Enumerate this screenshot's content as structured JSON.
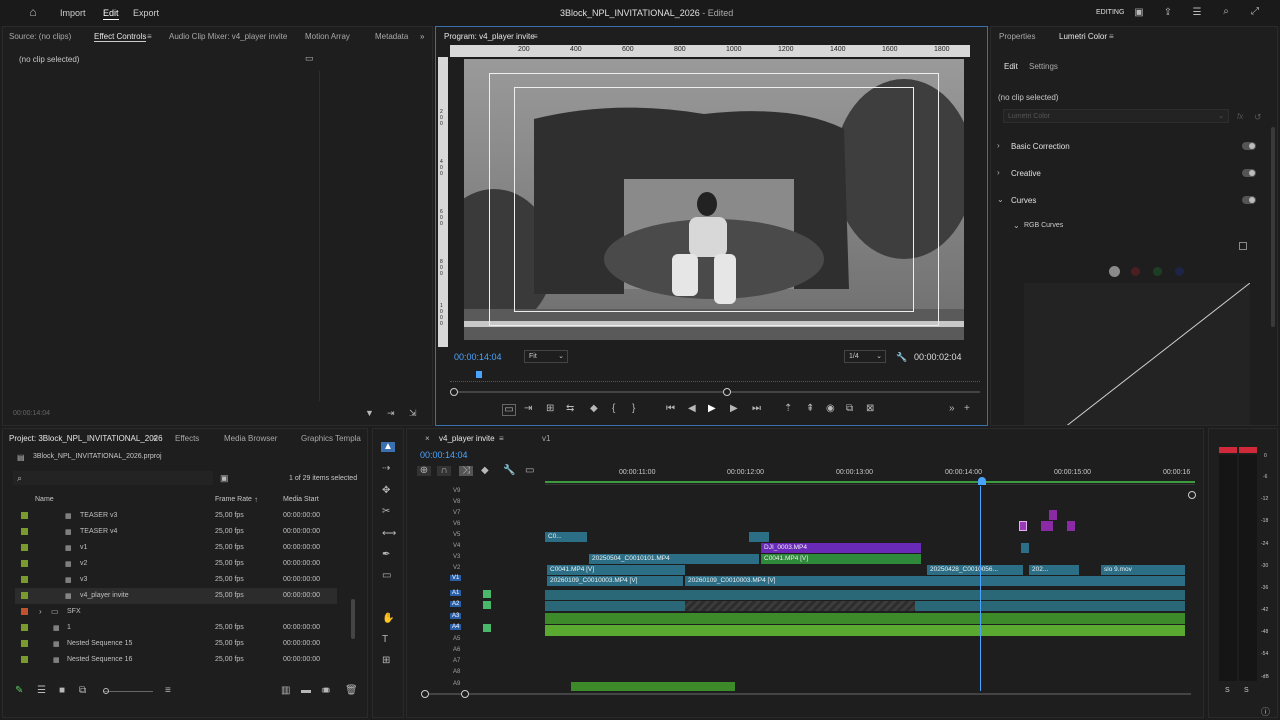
{
  "header": {
    "home_icon": "home-icon",
    "menu": [
      "Import",
      "Edit",
      "Export"
    ],
    "active_menu": "Edit",
    "title": "3Block_NPL_INVITATIONAL_2026",
    "status": "- Edited",
    "workspace": "EDITING"
  },
  "source_panel": {
    "tabs": [
      "Source: (no clips)",
      "Effect Controls",
      "Audio Clip Mixer: v4_player invite",
      "Motion Array",
      "Metadata"
    ],
    "no_clip": "(no clip selected)",
    "timecode": "00:00:14:04"
  },
  "program": {
    "tab": "Program: v4_player invite",
    "ruler": [
      "200",
      "400",
      "600",
      "800",
      "1000",
      "1200",
      "1400",
      "1600",
      "1800"
    ],
    "vruler": [
      "2 0 0",
      "4 0 0",
      "6 0 0",
      "8 0 0",
      "1 0 0 0"
    ],
    "timecode": "00:00:14:04",
    "fit": "Fit",
    "resolution": "1/4",
    "duration": "00:00:02:04"
  },
  "lumetri": {
    "tabs": [
      "Properties",
      "Lumetri Color"
    ],
    "subtabs": [
      "Edit",
      "Settings"
    ],
    "no_clip": "(no clip selected)",
    "effect_placeholder": "Lumetri Color",
    "sections": [
      "Basic Correction",
      "Creative",
      "Curves"
    ],
    "sub_section": "RGB Curves"
  },
  "project": {
    "tabs": [
      "Project: 3Block_NPL_INVITATIONAL_2026",
      "Effects",
      "Media Browser",
      "Graphics Templa"
    ],
    "file": "3Block_NPL_INVITATIONAL_2026.prproj",
    "selection": "1 of 29 items selected",
    "columns": [
      "Name",
      "Frame Rate",
      "Media Start"
    ],
    "rows": [
      {
        "name": "TEASER v3",
        "rate": "25,00 fps",
        "start": "00:00:00:00",
        "color": "#7a9a2e"
      },
      {
        "name": "TEASER v4",
        "rate": "25,00 fps",
        "start": "00:00:00:00",
        "color": "#7a9a2e"
      },
      {
        "name": "v1",
        "rate": "25,00 fps",
        "start": "00:00:00:00",
        "color": "#7a9a2e"
      },
      {
        "name": "v2",
        "rate": "25,00 fps",
        "start": "00:00:00:00",
        "color": "#7a9a2e"
      },
      {
        "name": "v3",
        "rate": "25,00 fps",
        "start": "00:00:00:00",
        "color": "#7a9a2e"
      },
      {
        "name": "v4_player invite",
        "rate": "25,00 fps",
        "start": "00:00:00:00",
        "color": "#7a9a2e"
      },
      {
        "name": "SFX",
        "rate": "",
        "start": "",
        "color": "#c0522e"
      },
      {
        "name": "1",
        "rate": "25,00 fps",
        "start": "00:00:00:00",
        "color": "#7a9a2e"
      },
      {
        "name": "Nested Sequence 15",
        "rate": "25,00 fps",
        "start": "00:00:00:00",
        "color": "#7a9a2e"
      },
      {
        "name": "Nested Sequence 16",
        "rate": "25,00 fps",
        "start": "00:00:00:00",
        "color": "#7a9a2e"
      }
    ]
  },
  "timeline": {
    "tabs": [
      "v4_player invite",
      "v1"
    ],
    "timecode": "00:00:14:04",
    "ruler": [
      "00:00:11:00",
      "00:00:12:00",
      "00:00:13:00",
      "00:00:14:00",
      "00:00:15:00",
      "00:00:16"
    ],
    "video_tracks": [
      "V9",
      "V8",
      "V7",
      "V6",
      "V5",
      "V4",
      "V3",
      "V2",
      "V1"
    ],
    "audio_tracks": [
      "A1",
      "A2",
      "A3",
      "A4",
      "A5",
      "A6",
      "A7",
      "A8",
      "A9"
    ],
    "clips": {
      "v5_a": "C0...",
      "v4_a": "DJI_0003.MP4",
      "v3_a": "20250504_C0010101.MP4",
      "v3_b": "C0041.MP4 [V]",
      "v2_a": "C0041.MP4 [V]",
      "v2_b": "20250428_C0010056...",
      "v2_c": "202...",
      "v2_d": "slo 9.mov",
      "v1_a": "20260109_C0010003.MP4 [V]",
      "v1_b": "20260109_C0010003.MP4 [V]"
    }
  },
  "meter": {
    "scale": [
      "0",
      "-6",
      "-12",
      "-18",
      "-24",
      "-30",
      "-36",
      "-42",
      "-48",
      "-54",
      "-dB"
    ],
    "solo": [
      "S",
      "S"
    ]
  }
}
